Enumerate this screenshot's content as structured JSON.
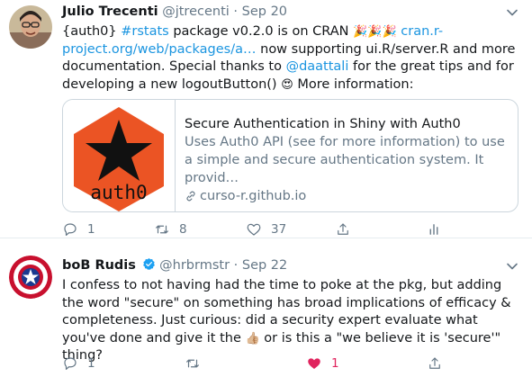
{
  "tweets": [
    {
      "display_name": "Julio Trecenti",
      "handle": "@jtrecenti",
      "date": "Sep 20",
      "text": {
        "p1": "{auth0} ",
        "hashtag": "#rstats",
        "p2": " package v0.2.0 is on CRAN ",
        "party_emoji": "🎉🎉🎉",
        "p3": " ",
        "url": "cran.r-project.org/web/packages/a…",
        "p4": " now supporting ui.R/server.R and more documentation. Special thanks to ",
        "mention": "@daattali",
        "p5": " for the great tips and for developing a new logoutButton() ",
        "love_emoji": "😍",
        "p6": " More information:"
      },
      "card": {
        "image_text": "auth0",
        "title": "Secure Authentication in Shiny with Auth0",
        "description": "Uses Auth0 API (see for more information) to use a simple and secure authentication system. It provid…",
        "domain": "curso-r.github.io"
      },
      "actions": {
        "replies": "1",
        "retweets": "8",
        "likes": "37"
      }
    },
    {
      "display_name": "boB Rudis",
      "handle": "@hrbrmstr",
      "date": "Sep 22",
      "text": {
        "p1": "I confess to not having had the time to poke at the pkg, but adding the word \"secure\" on something has broad implications of efficacy & completeness. Just curious: did a security expert evaluate what you've done and give it the ",
        "thumbs_emoji": "👍🏼",
        "p2": " or is this a \"we believe it is 'secure'\" thing?"
      },
      "actions": {
        "replies": "1",
        "retweets": "",
        "likes": "1"
      }
    }
  ],
  "colors": {
    "link": "#1b95e0",
    "muted": "#657786",
    "like_active": "#e0245e",
    "auth0_orange": "#eb5424"
  },
  "icons": [
    "reply-icon",
    "retweet-icon",
    "like-icon",
    "share-icon",
    "analytics-icon",
    "caret-down-icon",
    "verified-badge-icon",
    "link-icon"
  ]
}
